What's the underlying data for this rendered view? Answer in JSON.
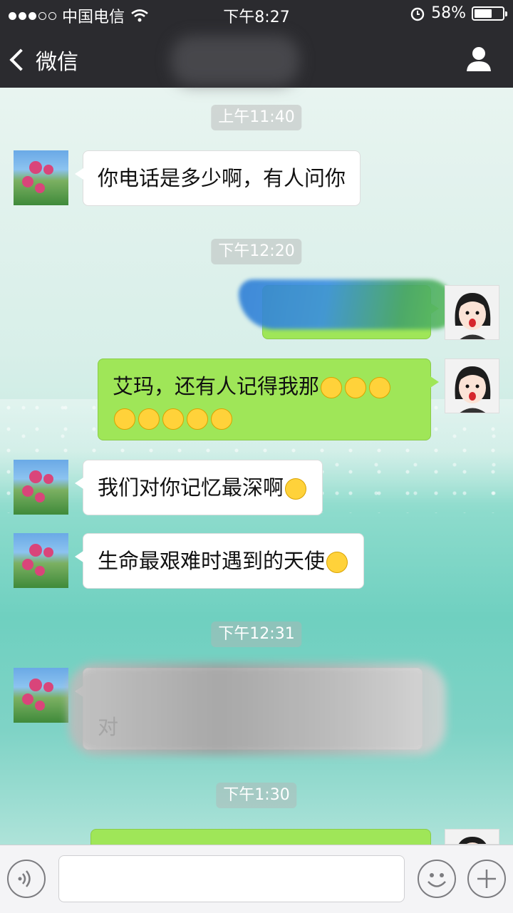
{
  "status_bar": {
    "carrier": "中国电信",
    "time": "下午8:27",
    "battery": "58%",
    "battery_level": 0.58
  },
  "nav": {
    "back_label": "微信"
  },
  "messages": {
    "ts1": "上午11:40",
    "m1": "你电话是多少啊，有人问你",
    "ts2": "下午12:20",
    "m3": "艾玛，还有人记得我那",
    "m4": "我们对你记忆最深啊",
    "m5": "生命最艰难时遇到的天使",
    "ts3": "下午12:31",
    "m6_fragment": "对",
    "ts4": "下午1:30"
  },
  "icons": {
    "wifi": "wifi-icon",
    "alarm": "alarm-icon",
    "user": "user-icon",
    "voice": "voice-icon",
    "emoji": "emoji-icon",
    "add": "add-icon"
  },
  "colors": {
    "header": "#2b2b2f",
    "sent_bubble": "#9fe658",
    "received_bubble": "#ffffff"
  }
}
